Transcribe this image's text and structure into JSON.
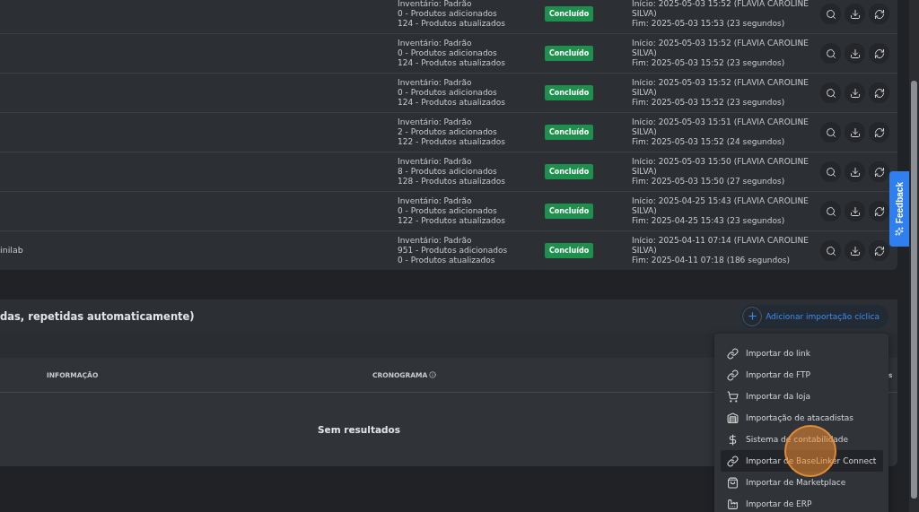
{
  "imports_table": {
    "rows": [
      {
        "info": [
          "Inventário: Padrão",
          "0 - Produtos adicionados",
          "124 - Produtos atualizados"
        ],
        "status": "Concluído",
        "start": "Início: 2025-05-03 15:52 (FLAVIA CAROLINE SILVA)",
        "end": "Fim: 2025-05-03 15:53 (23 segundos)"
      },
      {
        "info": [
          "Inventário: Padrão",
          "0 - Produtos adicionados",
          "124 - Produtos atualizados"
        ],
        "status": "Concluído",
        "start": "Início: 2025-05-03 15:52 (FLAVIA CAROLINE SILVA)",
        "end": "Fim: 2025-05-03 15:52 (23 segundos)"
      },
      {
        "info": [
          "Inventário: Padrão",
          "0 - Produtos adicionados",
          "124 - Produtos atualizados"
        ],
        "status": "Concluído",
        "start": "Início: 2025-05-03 15:52 (FLAVIA CAROLINE SILVA)",
        "end": "Fim: 2025-05-03 15:52 (23 segundos)"
      },
      {
        "info": [
          "Inventário: Padrão",
          "2 - Produtos adicionados",
          "122 - Produtos atualizados"
        ],
        "status": "Concluído",
        "start": "Início: 2025-05-03 15:51 (FLAVIA CAROLINE SILVA)",
        "end": "Fim: 2025-05-03 15:52 (24 segundos)"
      },
      {
        "info": [
          "Inventário: Padrão",
          "8 - Produtos adicionados",
          "128 - Produtos atualizados"
        ],
        "status": "Concluído",
        "start": "Início: 2025-05-03 15:50 (FLAVIA CAROLINE SILVA)",
        "end": "Fim: 2025-05-03 15:50 (27 segundos)"
      },
      {
        "info": [
          "Inventário: Padrão",
          "0 - Produtos adicionados",
          "122 - Produtos atualizados"
        ],
        "status": "Concluído",
        "start": "Início: 2025-04-25 15:43 (FLAVIA CAROLINE SILVA)",
        "end": "Fim: 2025-04-25 15:43 (23 segundos)"
      },
      {
        "name": "inilab",
        "info": [
          "Inventário: Padrão",
          "951 - Produtos adicionados",
          "0 - Produtos atualizados"
        ],
        "status": "Concluído",
        "start": "Início: 2025-04-11 07:14 (FLAVIA CAROLINE SILVA)",
        "end": "Fim: 2025-04-11 07:18 (186 segundos)"
      }
    ]
  },
  "cyclic_imports": {
    "title": "das, repetidas automaticamente)",
    "add_button": "Adicionar importação cíclica",
    "columns": [
      {
        "label": "INFORMAÇÃO",
        "info": false
      },
      {
        "label": "CRONOGRAMA",
        "info": true
      },
      {
        "label": "s",
        "info": false
      }
    ],
    "empty_text": "Sem resultados"
  },
  "import_menu": {
    "items": [
      {
        "label": "Importar do link",
        "selected": false
      },
      {
        "label": "Importar de FTP",
        "selected": false
      },
      {
        "label": "Importar da loja",
        "selected": false
      },
      {
        "label": "Importação de atacadistas",
        "selected": false
      },
      {
        "label": "Sistema de contabilidade",
        "selected": false
      },
      {
        "label": "Importar de BaseLinker Connect",
        "selected": true
      },
      {
        "label": "Importar de Marketplace",
        "selected": false
      },
      {
        "label": "Importar de ERP",
        "selected": false
      }
    ]
  },
  "feedback_tab": "Feedback"
}
